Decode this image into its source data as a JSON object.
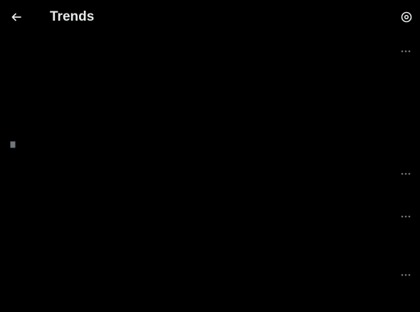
{
  "header": {
    "title": "Trends",
    "back_icon": "arrow-left-icon",
    "settings_icon": "gear-icon"
  },
  "trends": [
    {
      "meta": "",
      "name": "",
      "count": "",
      "more_icon": "more-icon"
    },
    {
      "name": "",
      "description": "",
      "promoted_by": "",
      "promoted_icon": "promoted-icon"
    },
    {
      "meta": "",
      "name": "",
      "more_icon": "more-icon"
    },
    {
      "meta": "",
      "name": "",
      "count": "",
      "more_icon": "more-icon"
    },
    {
      "meta": "",
      "name": "",
      "count": "",
      "more_icon": "more-icon"
    }
  ],
  "colors": {
    "background": "#000000",
    "primary_text": "#e7e9ea",
    "secondary_text": "#71767b"
  }
}
